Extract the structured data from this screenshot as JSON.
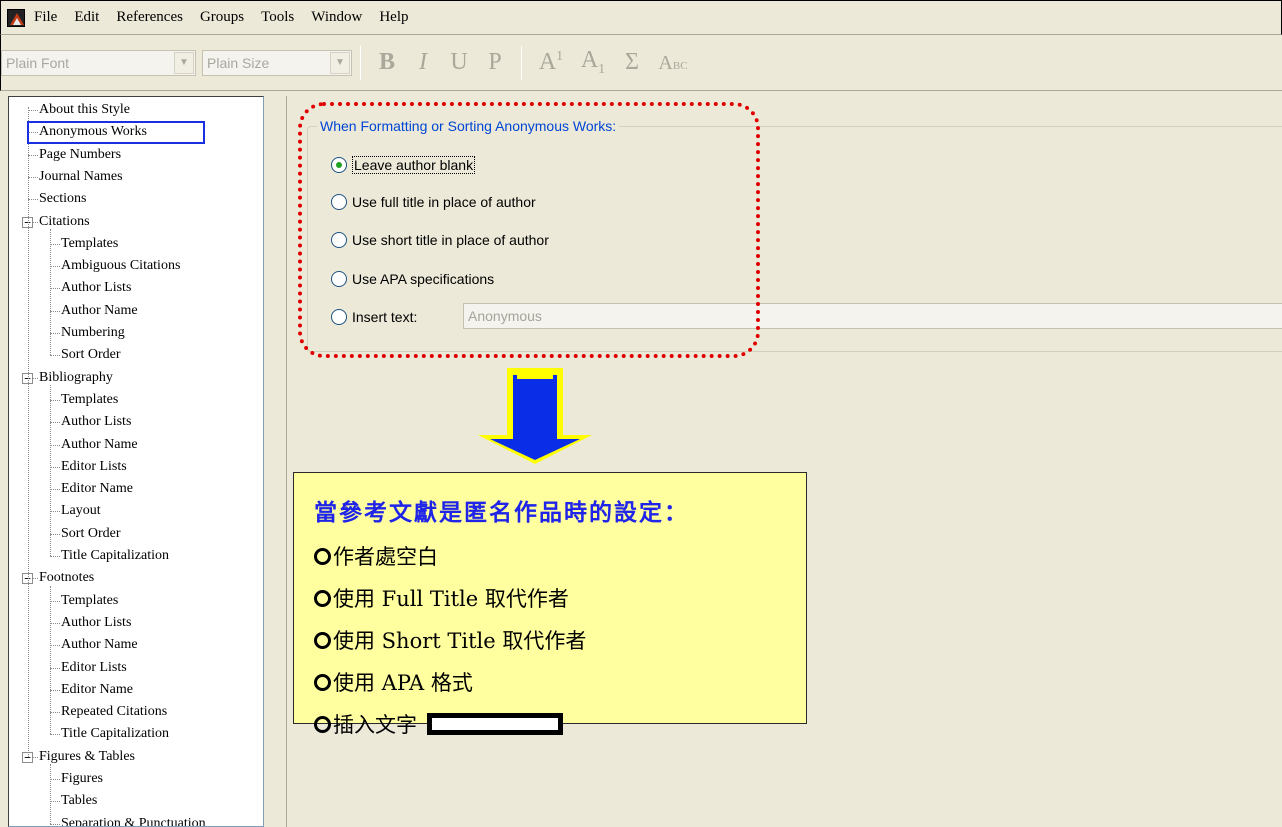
{
  "menu": {
    "items": [
      "File",
      "Edit",
      "References",
      "Groups",
      "Tools",
      "Window",
      "Help"
    ]
  },
  "toolbar": {
    "font_value": "Plain Font",
    "size_value": "Plain Size",
    "bold": "B",
    "italic": "I",
    "underline": "U",
    "plain": "P",
    "superscript_base": "A",
    "superscript_mark": "1",
    "subscript_base": "A",
    "subscript_mark": "1",
    "symbol": "Σ",
    "smallcaps_big": "A",
    "smallcaps_small": "BC"
  },
  "tree": {
    "items": [
      "About this Style",
      "Anonymous Works",
      "Page Numbers",
      "Journal Names",
      "Sections",
      "Citations",
      "Templates",
      "Ambiguous Citations",
      "Author Lists",
      "Author Name",
      "Numbering",
      "Sort Order",
      "Bibliography",
      "Templates",
      "Author Lists",
      "Author Name",
      "Editor Lists",
      "Editor Name",
      "Layout",
      "Sort Order",
      "Title Capitalization",
      "Footnotes",
      "Templates",
      "Author Lists",
      "Author Name",
      "Editor Lists",
      "Editor Name",
      "Repeated Citations",
      "Title Capitalization",
      "Figures & Tables",
      "Figures",
      "Tables",
      "Separation & Punctuation"
    ],
    "selected": "Anonymous Works"
  },
  "group": {
    "legend": "When Formatting or Sorting Anonymous Works:",
    "options": [
      "Leave author blank",
      "Use full title in place of author",
      "Use short title in place of author",
      "Use APA specifications",
      "Insert text:"
    ],
    "selected_index": 0,
    "insert_value": "Anonymous"
  },
  "note": {
    "title": "當參考文獻是匿名作品時的設定：",
    "lines": [
      "作者處空白",
      "使用 Full Title 取代作者",
      "使用 Short Title 取代作者",
      "使用 APA 格式",
      "插入文字"
    ]
  },
  "colors": {
    "window_bg": "#ece9d8",
    "selection_outline": "#1a2fe0",
    "callout_red": "#e00000",
    "arrow_blue": "#0a2ee8",
    "arrow_yellow": "#ffff00",
    "note_bg": "#ffffa0",
    "note_title": "#1f24e8",
    "legend_blue": "#0046d5"
  }
}
